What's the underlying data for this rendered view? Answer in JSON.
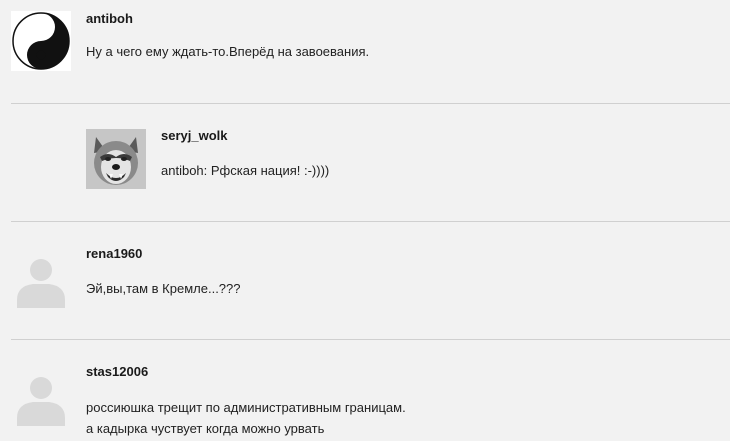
{
  "comments": [
    {
      "author": "antiboh",
      "avatar_icon": "yin-yang-icon",
      "lines": [
        "Ну а чего ему ждать-то.Вперёд на завоевания."
      ]
    },
    {
      "author": "seryj_wolk",
      "avatar_icon": "wolf-photo",
      "reply": true,
      "lines": [
        "antiboh: Рфская нация! :-))))"
      ]
    },
    {
      "author": "rena1960",
      "avatar_icon": "default-user-icon",
      "lines": [
        "Эй,вы,там в Кремле...???"
      ]
    },
    {
      "author": "stas12006",
      "avatar_icon": "default-user-icon",
      "lines": [
        "россиюшка трещит по административным границам.",
        "а кадырка чуствует когда можно урвать"
      ]
    }
  ],
  "colors": {
    "background": "#f2f2f2",
    "divider": "#d0d0d0",
    "placeholder_avatar": "#d9d9d9"
  }
}
